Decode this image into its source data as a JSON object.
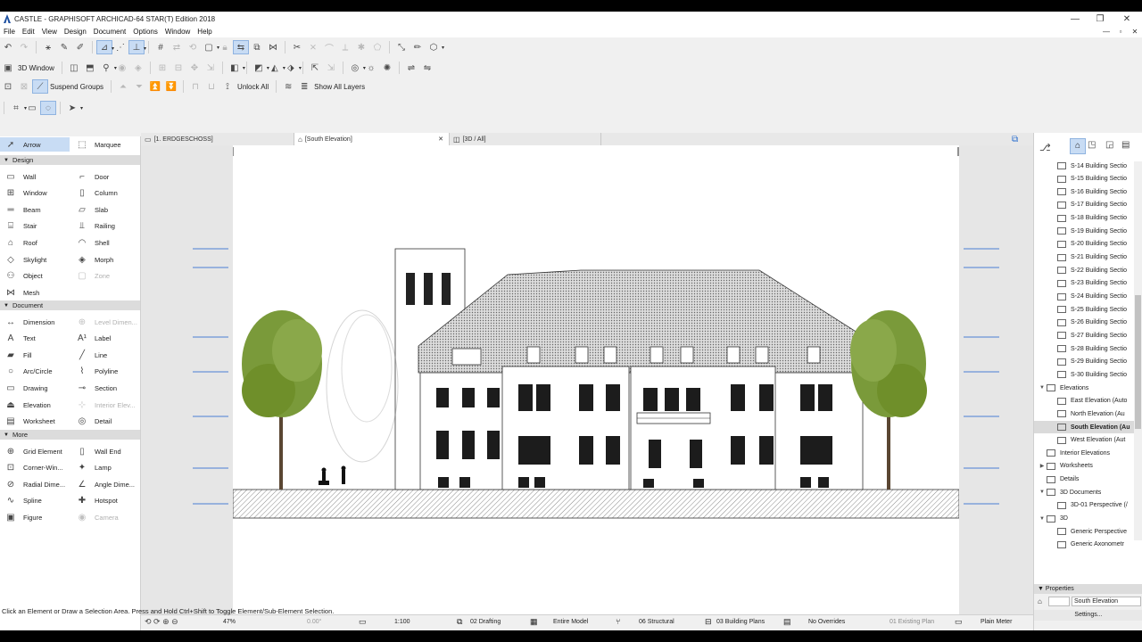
{
  "window": {
    "title": "CASTLE - GRAPHISOFT ARCHICAD-64 STAR(T) Edition 2018",
    "controls": [
      "—",
      "❐",
      "✕"
    ],
    "mdi_controls": [
      "—",
      "▫",
      "✕"
    ]
  },
  "menu": [
    "File",
    "Edit",
    "View",
    "Design",
    "Document",
    "Options",
    "Window",
    "Help"
  ],
  "toolbar": {
    "view_3d_label": "3D Window",
    "suspend_groups_label": "Suspend Groups",
    "unlock_all_label": "Unlock All",
    "show_all_layers_label": "Show All Layers"
  },
  "toolbox": {
    "arrow": "Arrow",
    "marquee": "Marquee",
    "groups": [
      {
        "label": "Design",
        "tools": [
          [
            "Wall",
            "Door"
          ],
          [
            "Window",
            "Column"
          ],
          [
            "Beam",
            "Slab"
          ],
          [
            "Stair",
            "Railing"
          ],
          [
            "Roof",
            "Shell"
          ],
          [
            "Skylight",
            "Morph"
          ],
          [
            "Object",
            "Zone"
          ],
          [
            "Mesh",
            ""
          ]
        ]
      },
      {
        "label": "Document",
        "tools": [
          [
            "Dimension",
            "Level Dimen..."
          ],
          [
            "Text",
            "Label"
          ],
          [
            "Fill",
            "Line"
          ],
          [
            "Arc/Circle",
            "Polyline"
          ],
          [
            "Drawing",
            "Section"
          ],
          [
            "Elevation",
            "Interior Elev..."
          ],
          [
            "Worksheet",
            "Detail"
          ]
        ]
      },
      {
        "label": "More",
        "tools": [
          [
            "Grid Element",
            "Wall End"
          ],
          [
            "Corner-Win...",
            "Lamp"
          ],
          [
            "Radial Dime...",
            "Angle Dime..."
          ],
          [
            "Spline",
            "Hotspot"
          ],
          [
            "Figure",
            "Camera"
          ]
        ]
      }
    ]
  },
  "tabs": [
    {
      "label": "[1. ERDGESCHOSS]"
    },
    {
      "label": "[South Elevation]",
      "close": "✕"
    },
    {
      "label": "[3D / All]"
    }
  ],
  "navigator": {
    "sections": [
      "S-14 Building Sectio",
      "S-15 Building Sectio",
      "S-16 Building Sectio",
      "S-17 Building Sectio",
      "S-18 Building Sectio",
      "S-19 Building Sectio",
      "S-20 Building Sectio",
      "S-21 Building Sectio",
      "S-22 Building Sectio",
      "S-23 Building Sectio",
      "S-24 Building Sectio",
      "S-25 Building Sectio",
      "S-26 Building Sectio",
      "S-27 Building Sectio",
      "S-28 Building Sectio",
      "S-29 Building Sectio",
      "S-30 Building Sectio"
    ],
    "elevations_label": "Elevations",
    "elevations": [
      "East Elevation (Auto",
      "North Elevation (Au",
      "South Elevation (Au",
      "West Elevation (Aut"
    ],
    "selected_elevation": "South Elevation (Au",
    "others": [
      "Interior Elevations",
      "Worksheets",
      "Details",
      "3D Documents",
      "3D-01 Perspective (/",
      "3D",
      "Generic Perspective",
      "Generic Axonometr"
    ]
  },
  "properties": {
    "header": "Properties",
    "name": "South Elevation",
    "settings_label": "Settings..."
  },
  "statusbar": {
    "zoom": "47%",
    "angle": "0.00°",
    "scale": "1:100",
    "layer_combo": "02 Drafting",
    "model_view": "Entire Model",
    "pen_set": "06 Structural",
    "mvo": "03 Building Plans",
    "overrides": "No Overrides",
    "renovation": "01 Existing Plan",
    "dimension": "Plain Meter"
  },
  "hint": "Click an Element or Draw a Selection Area. Press and Hold Ctrl+Shift to Toggle Element/Sub-Element Selection.",
  "colors": {
    "accent": "#c8dcf4",
    "selection_blue": "#4a7fd4",
    "tree_green": "#6f8f2a"
  }
}
